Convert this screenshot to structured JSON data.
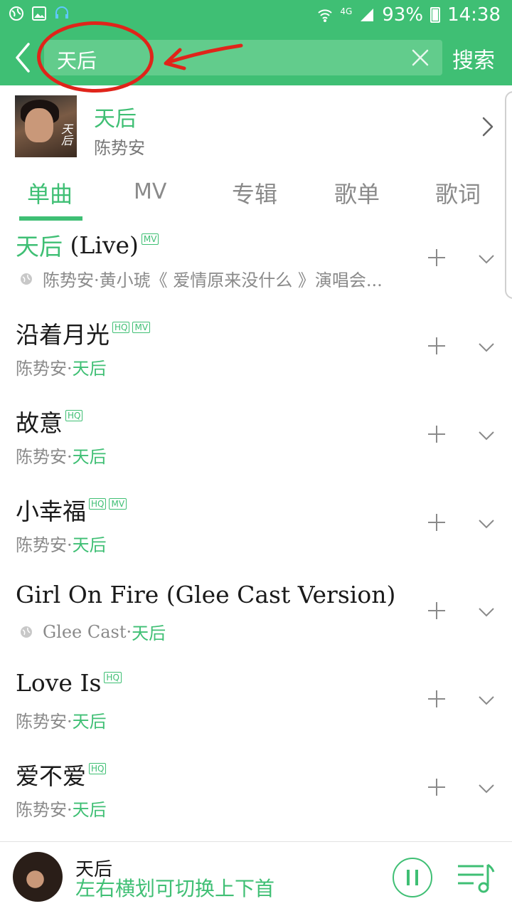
{
  "status_bar": {
    "network": "4G",
    "battery": "93%",
    "time": "14:38"
  },
  "header": {
    "search_value": "天后",
    "search_button": "搜索"
  },
  "album": {
    "title": "天后",
    "artist": "陈势安"
  },
  "tabs": [
    "单曲",
    "MV",
    "专辑",
    "歌单",
    "歌词"
  ],
  "songs": [
    {
      "title_hl": "天后",
      "title_rest": " (Live)",
      "badges": [
        "MV"
      ],
      "artist": "陈势安·黄小琥《 爱情原来没什么 》演唱会...",
      "album": ""
    },
    {
      "title_hl": "",
      "title_rest": "沿着月光",
      "badges": [
        "HQ",
        "MV"
      ],
      "artist": "陈势安·",
      "album": "天后"
    },
    {
      "title_hl": "",
      "title_rest": "故意",
      "badges": [
        "HQ"
      ],
      "artist": "陈势安·",
      "album": "天后"
    },
    {
      "title_hl": "",
      "title_rest": "小幸福",
      "badges": [
        "HQ",
        "MV"
      ],
      "artist": "陈势安·",
      "album": "天后"
    },
    {
      "title_hl": "",
      "title_rest": "Girl On Fire (Glee Cast Version)",
      "badges": [],
      "artist": "Glee Cast·",
      "album": "天后"
    },
    {
      "title_hl": "",
      "title_rest": "Love Is",
      "badges": [
        "HQ"
      ],
      "artist": "陈势安·",
      "album": "天后"
    },
    {
      "title_hl": "",
      "title_rest": "爱不爱",
      "badges": [
        "HQ"
      ],
      "artist": "陈势安·",
      "album": "天后"
    }
  ],
  "player": {
    "title": "天后",
    "hint": "左右横划可切换上下首"
  }
}
